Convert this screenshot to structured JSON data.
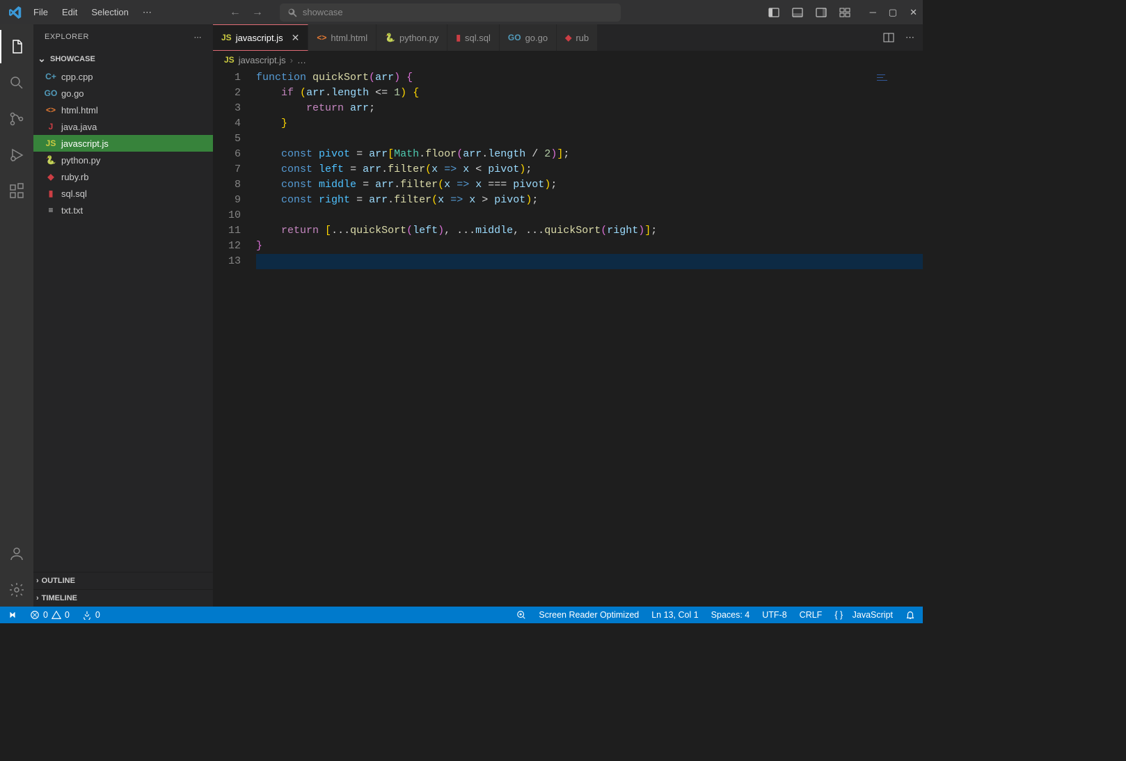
{
  "titlebar": {
    "menu": [
      "File",
      "Edit",
      "Selection"
    ],
    "search_placeholder": "showcase"
  },
  "activitybar": {
    "items": [
      "explorer",
      "search",
      "source-control",
      "run-debug",
      "extensions"
    ],
    "bottom": [
      "account",
      "settings"
    ]
  },
  "sidebar": {
    "title": "EXPLORER",
    "workspace": "SHOWCASE",
    "files": [
      {
        "icon": "C+",
        "color": "#519aba",
        "name": "cpp.cpp"
      },
      {
        "icon": "GO",
        "color": "#519aba",
        "name": "go.go"
      },
      {
        "icon": "<>",
        "color": "#e37933",
        "name": "html.html"
      },
      {
        "icon": "J",
        "color": "#cc3e44",
        "name": "java.java"
      },
      {
        "icon": "JS",
        "color": "#cbcb41",
        "name": "javascript.js"
      },
      {
        "icon": "🐍",
        "color": "#519aba",
        "name": "python.py"
      },
      {
        "icon": "◆",
        "color": "#cc3e44",
        "name": "ruby.rb"
      },
      {
        "icon": "▮",
        "color": "#cc3e44",
        "name": "sql.sql"
      },
      {
        "icon": "≡",
        "color": "#cccccc",
        "name": "txt.txt"
      }
    ],
    "outline": "OUTLINE",
    "timeline": "TIMELINE"
  },
  "tabs": {
    "items": [
      {
        "icon": "JS",
        "color": "#cbcb41",
        "label": "javascript.js",
        "active": true
      },
      {
        "icon": "<>",
        "color": "#e37933",
        "label": "html.html"
      },
      {
        "icon": "🐍",
        "color": "#519aba",
        "label": "python.py"
      },
      {
        "icon": "▮",
        "color": "#cc3e44",
        "label": "sql.sql"
      },
      {
        "icon": "GO",
        "color": "#519aba",
        "label": "go.go"
      },
      {
        "icon": "◆",
        "color": "#cc3e44",
        "label": "rub"
      }
    ]
  },
  "breadcrumb": {
    "icon": "JS",
    "file": "javascript.js",
    "tail": "…"
  },
  "code": {
    "lines": 13
  },
  "statusbar": {
    "errors": "0",
    "warnings": "0",
    "ports": "0",
    "screen_reader": "Screen Reader Optimized",
    "ln_col": "Ln 13, Col 1",
    "spaces": "Spaces: 4",
    "encoding": "UTF-8",
    "eol": "CRLF",
    "lang": "JavaScript"
  }
}
